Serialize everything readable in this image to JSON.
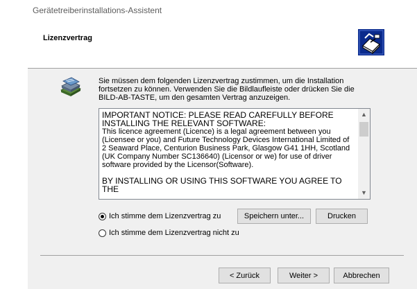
{
  "window": {
    "title": "Gerätetreiberinstallations-Assistent"
  },
  "header": {
    "title": "Lizenzvertrag",
    "icon": "driver-setup-icon"
  },
  "main": {
    "icon": "license-books-icon",
    "intro": "Sie müssen dem folgenden Lizenzvertrag zustimmen, um die Installation fortsetzen zu können. Verwenden Sie die Bildlaufleiste oder drücken Sie die BILD-AB-TASTE, um den gesamten Vertrag anzuzeigen.",
    "license": {
      "notice": "IMPORTANT NOTICE: PLEASE READ CAREFULLY BEFORE INSTALLING THE RELEVANT SOFTWARE:",
      "body": "This licence agreement (Licence) is a legal agreement between you (Licensee or you) and Future Technology Devices International Limited of 2 Seaward Place, Centurion Business Park, Glasgow G41 1HH, Scotland (UK Company Number SC136640) (Licensor or we) for use of driver software provided by the Licensor(Software).",
      "footer": "BY INSTALLING OR USING THIS SOFTWARE YOU AGREE TO THE"
    },
    "radios": {
      "accept": "Ich stimme dem Lizenzvertrag zu",
      "decline": "Ich stimme dem Lizenzvertrag nicht zu",
      "selected": "accept"
    },
    "buttons": {
      "save": "Speichern unter...",
      "print": "Drucken"
    }
  },
  "footer": {
    "back": "< Zurück",
    "next": "Weiter >",
    "cancel": "Abbrechen"
  }
}
